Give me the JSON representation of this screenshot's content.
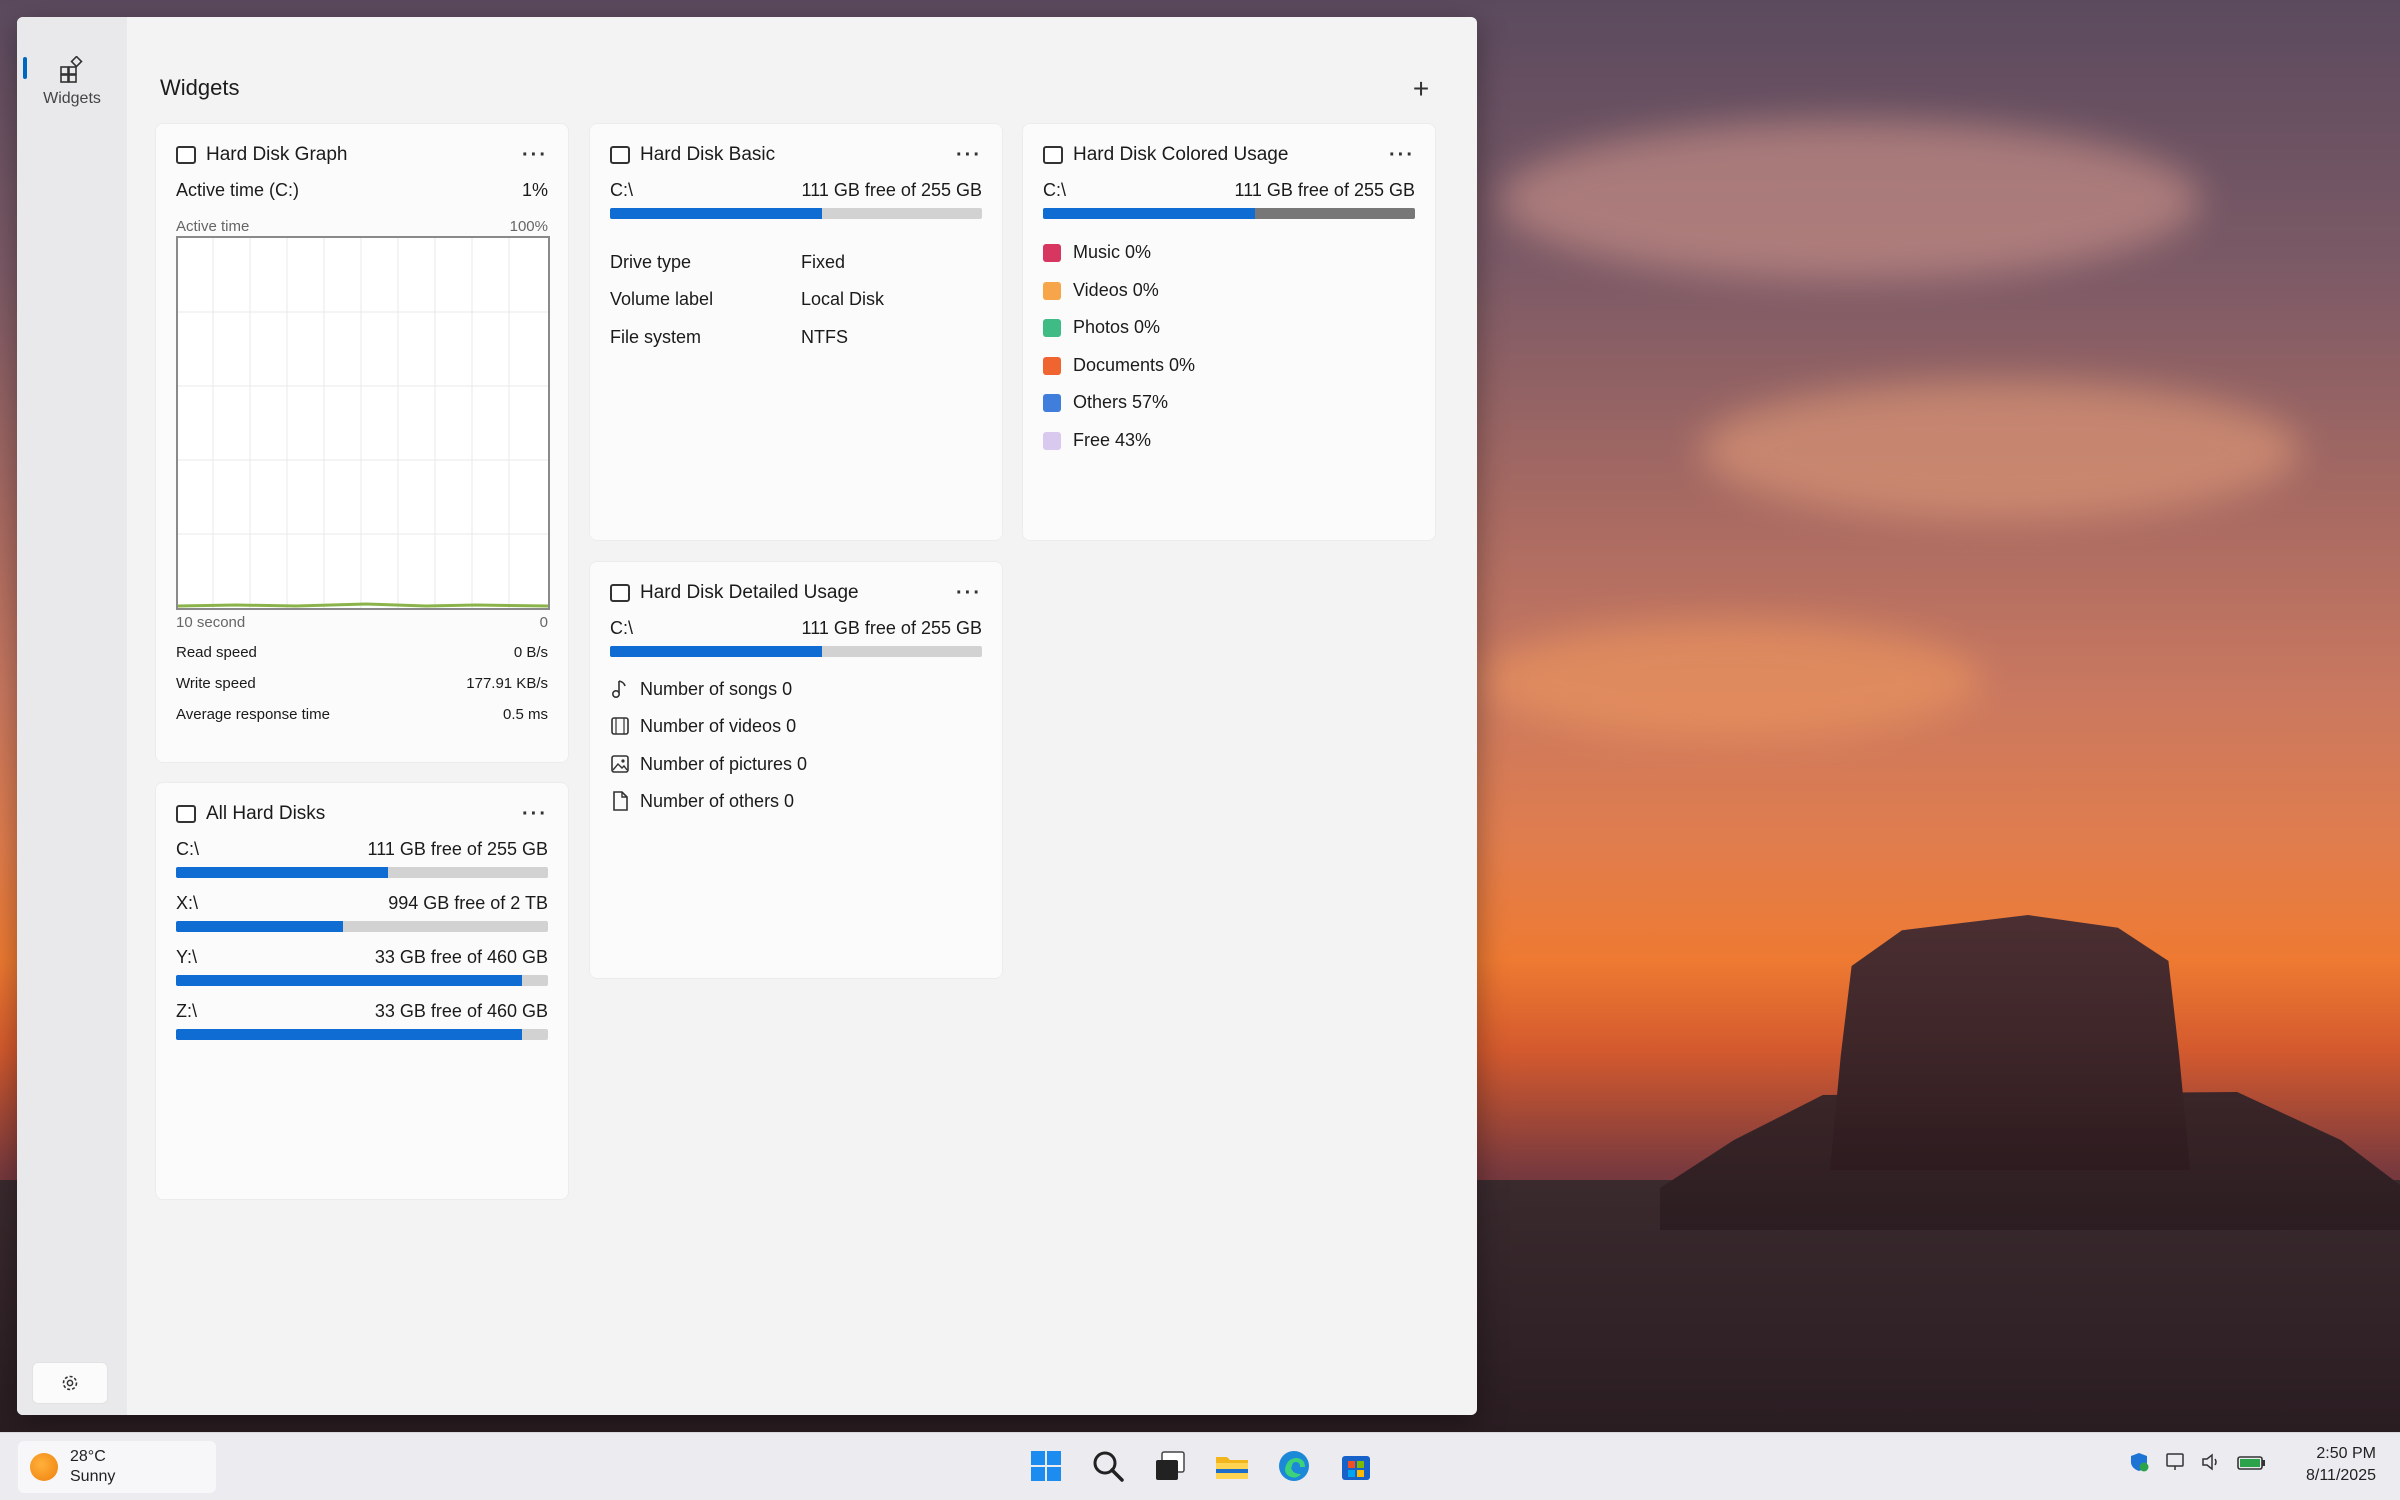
{
  "nav": {
    "widgets_label": "Widgets"
  },
  "content": {
    "title": "Widgets",
    "add_label": "+"
  },
  "graph_card": {
    "title": "Hard Disk Graph",
    "active_label": "Active time (C:)",
    "active_value": "1%",
    "graph_caption_left": "Active time",
    "graph_caption_right": "100%",
    "axis_left": "10 second",
    "axis_right": "0",
    "stats": [
      {
        "label": "Read speed",
        "value": "0 B/s"
      },
      {
        "label": "Write speed",
        "value": "177.91 KB/s"
      },
      {
        "label": "Average response time",
        "value": "0.5 ms"
      }
    ]
  },
  "basic_card": {
    "title": "Hard Disk Basic",
    "drive": "C:\\",
    "free_text": "111 GB free of 255 GB",
    "used_fraction": 0.57,
    "details": [
      {
        "k": "Drive type",
        "v": "Fixed"
      },
      {
        "k": "Volume label",
        "v": "Local Disk"
      },
      {
        "k": "File system",
        "v": "NTFS"
      }
    ]
  },
  "colored_card": {
    "title": "Hard Disk Colored Usage",
    "drive": "C:\\",
    "free_text": "111 GB free of 255 GB",
    "legend": [
      {
        "label": "Music 0%",
        "color": "#d6365f"
      },
      {
        "label": "Videos 0%",
        "color": "#f6a54a"
      },
      {
        "label": "Photos 0%",
        "color": "#3fbb86"
      },
      {
        "label": "Documents 0%",
        "color": "#f0642f"
      },
      {
        "label": "Others 57%",
        "color": "#3f7fdb"
      },
      {
        "label": "Free 43%",
        "color": "#d9c9ef"
      }
    ],
    "others_fraction": 0.57,
    "free_fraction": 0.43
  },
  "detailed_card": {
    "title": "Hard Disk Detailed Usage",
    "drive": "C:\\",
    "free_text": "111 GB free of 255 GB",
    "used_fraction": 0.57,
    "items": [
      {
        "label": "Number of songs 0",
        "icon": "music-note-icon"
      },
      {
        "label": "Number of videos 0",
        "icon": "film-icon"
      },
      {
        "label": "Number of pictures 0",
        "icon": "picture-icon"
      },
      {
        "label": "Number of others 0",
        "icon": "document-icon"
      }
    ]
  },
  "all_card": {
    "title": "All Hard Disks",
    "disks": [
      {
        "drive": "C:\\",
        "free_text": "111 GB free of 255 GB",
        "used_fraction": 0.57
      },
      {
        "drive": "X:\\",
        "free_text": "994 GB free of 2 TB",
        "used_fraction": 0.45
      },
      {
        "drive": "Y:\\",
        "free_text": "33 GB free of 460 GB",
        "used_fraction": 0.93
      },
      {
        "drive": "Z:\\",
        "free_text": "33 GB free of 460 GB",
        "used_fraction": 0.93
      }
    ]
  },
  "taskbar": {
    "temperature": "28°C",
    "condition": "Sunny",
    "time": "2:50 PM",
    "date": "8/11/2025"
  },
  "colors": {
    "accent": "#0f6cd2",
    "bar_track": "#d2d2d2",
    "others_fill": "#777777"
  }
}
